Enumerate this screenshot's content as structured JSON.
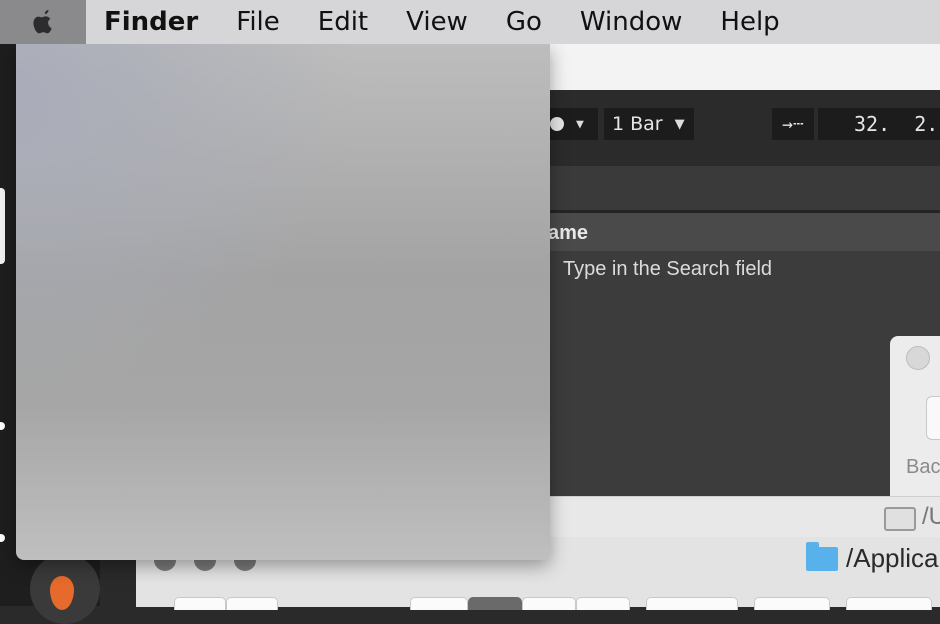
{
  "menubar": {
    "app_name": "Finder",
    "items": [
      "File",
      "Edit",
      "View",
      "Go",
      "Window",
      "Help"
    ]
  },
  "daw": {
    "quantize": "1 Bar",
    "arrangement_position": "32.  2.",
    "browser_column_header": "ame",
    "browser_hint": "Type in the Search field"
  },
  "dialog": {
    "partial_label": "Bac"
  },
  "finder": {
    "top_path": "/U",
    "title": "/Applica"
  },
  "colors": {
    "menubar": "#d6d6d8",
    "menu_blur": "#a6a6a6",
    "daw_dark": "#3c3c3c",
    "folder_blue": "#58b1ea",
    "dock_accent": "#e56a2b"
  }
}
